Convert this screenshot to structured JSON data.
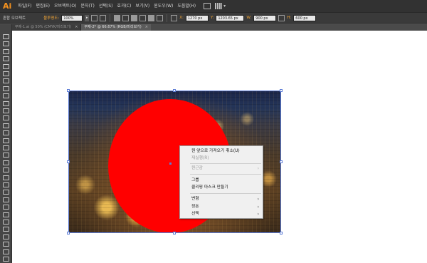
{
  "app": {
    "logo": "Ai"
  },
  "menubar": {
    "items": [
      "파일(F)",
      "편집(E)",
      "오브젝트(O)",
      "문자(T)",
      "선택(S)",
      "효과(C)",
      "보기(V)",
      "윈도우(W)",
      "도움말(H)"
    ]
  },
  "controlbar": {
    "object_label": "혼합 오브젝트",
    "opacity_label": "불투명도:",
    "opacity_value": "100%",
    "x_label": "X:",
    "x_value": "1270 px",
    "y_label": "Y:",
    "y_value": "1203.65 px",
    "w_label": "W:",
    "w_value": "900 px",
    "h_label": "H:",
    "h_value": "600 px"
  },
  "tabs": [
    {
      "label": "무제-1.ai @ 50% (CMYK/미리보기)",
      "close": "×",
      "active": false
    },
    {
      "label": "무제-2* @ 66.67% (RGB/미리보기)",
      "close": "×",
      "active": true
    }
  ],
  "context_menu": {
    "items": [
      {
        "label": "원 앞으로 가져오기 취소(U)",
        "disabled": false,
        "submenu": false
      },
      {
        "label": "재실행(R)",
        "disabled": true,
        "submenu": false
      },
      {
        "label": "원근감",
        "disabled": true,
        "submenu": true
      },
      {
        "label": "그룹",
        "disabled": false,
        "submenu": false
      },
      {
        "label": "클리핑 마스크 만들기",
        "disabled": false,
        "submenu": false
      },
      {
        "label": "변형",
        "disabled": false,
        "submenu": true
      },
      {
        "label": "정돈",
        "disabled": false,
        "submenu": true
      },
      {
        "label": "선택",
        "disabled": false,
        "submenu": true
      }
    ],
    "arrow": "›"
  },
  "colors": {
    "accent": "#f7931e",
    "circle_fill": "#ff0000",
    "selection": "#5b7bd5"
  }
}
